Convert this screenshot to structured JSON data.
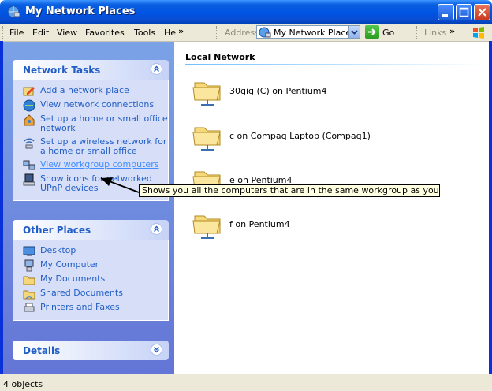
{
  "window": {
    "title": "My Network Places"
  },
  "menubar": {
    "items": [
      "File",
      "Edit",
      "View",
      "Favorites",
      "Tools",
      "He"
    ],
    "address_label": "Address",
    "address_value": "My Network Places",
    "go_label": "Go",
    "links_label": "Links"
  },
  "left": {
    "network_tasks": {
      "title": "Network Tasks",
      "items": [
        {
          "label": "Add a network place",
          "icon": "add-network-place-icon"
        },
        {
          "label": "View network connections",
          "icon": "network-connections-icon"
        },
        {
          "label": "Set up a home or small office network",
          "icon": "home-network-icon"
        },
        {
          "label": "Set up a wireless network for a home or small office",
          "icon": "wireless-network-icon"
        },
        {
          "label": "View workgroup computers",
          "icon": "workgroup-computers-icon"
        },
        {
          "label": "Show icons for networked UPnP devices",
          "icon": "upnp-devices-icon"
        }
      ]
    },
    "other_places": {
      "title": "Other Places",
      "items": [
        {
          "label": "Desktop",
          "icon": "desktop-icon"
        },
        {
          "label": "My Computer",
          "icon": "my-computer-icon"
        },
        {
          "label": "My Documents",
          "icon": "my-documents-icon"
        },
        {
          "label": "Shared Documents",
          "icon": "shared-documents-icon"
        },
        {
          "label": "Printers and Faxes",
          "icon": "printers-faxes-icon"
        }
      ]
    },
    "details": {
      "title": "Details"
    }
  },
  "main": {
    "group_title": "Local Network",
    "items": [
      {
        "label": "30gig (C) on Pentium4"
      },
      {
        "label": "c on Compaq Laptop (Compaq1)"
      },
      {
        "label": "e on Pentium4"
      },
      {
        "label": "f on Pentium4"
      }
    ]
  },
  "tooltip": {
    "text": "Shows you all the computers that are in the same workgroup as your computer."
  },
  "status": {
    "text": "4 objects"
  },
  "colors": {
    "accent": "#0054e3",
    "task_text": "#215dc6",
    "panel_bg": "#d6dff7"
  }
}
